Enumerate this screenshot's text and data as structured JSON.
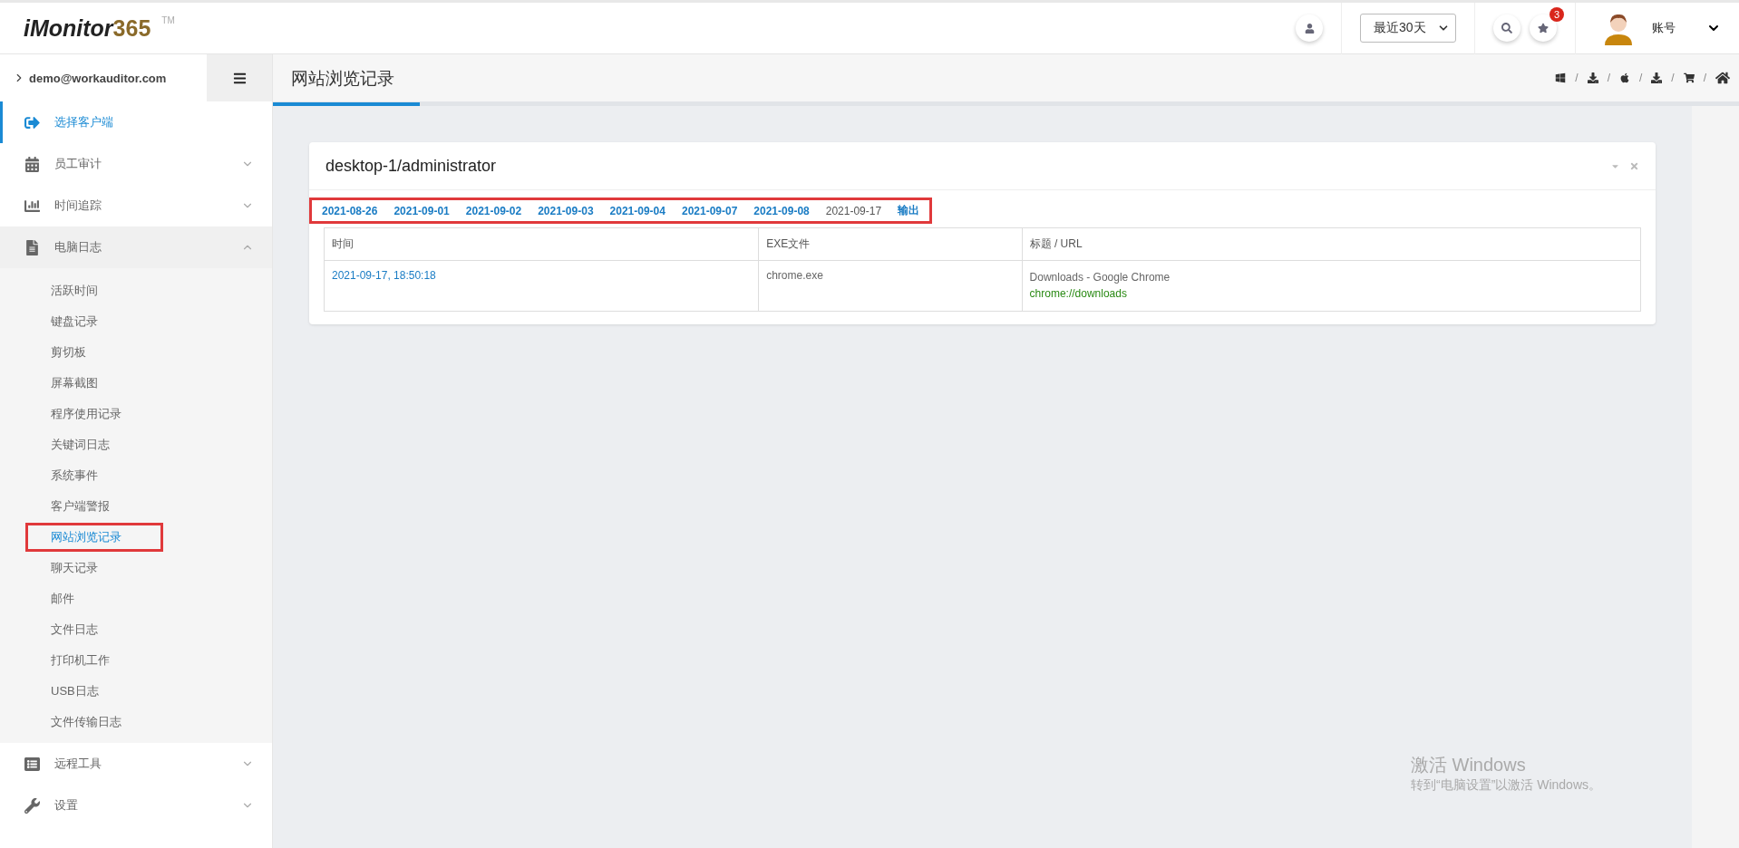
{
  "header": {
    "logo": {
      "name": "iMonitor",
      "number": "365",
      "tm": "TM"
    },
    "period_select": {
      "value": "最近30天"
    },
    "notification_count": "3",
    "account": "账号"
  },
  "sidebar": {
    "user": "demo@workauditor.com",
    "items": [
      {
        "label": "选择客户端",
        "selected": true
      },
      {
        "label": "员工审计",
        "selected": false,
        "expanded": false
      },
      {
        "label": "时间追踪",
        "selected": false,
        "expanded": false
      },
      {
        "label": "电脑日志",
        "selected": false,
        "expanded": true,
        "children": [
          {
            "label": "活跃时间",
            "selected": false,
            "highlighted": false
          },
          {
            "label": "键盘记录",
            "selected": false,
            "highlighted": false
          },
          {
            "label": "剪切板",
            "selected": false,
            "highlighted": false
          },
          {
            "label": "屏幕截图",
            "selected": false,
            "highlighted": false
          },
          {
            "label": "程序使用记录",
            "selected": false,
            "highlighted": false
          },
          {
            "label": "关键词日志",
            "selected": false,
            "highlighted": false
          },
          {
            "label": "系统事件",
            "selected": false,
            "highlighted": false
          },
          {
            "label": "客户端警报",
            "selected": false,
            "highlighted": false
          },
          {
            "label": "网站浏览记录",
            "selected": true,
            "highlighted": true
          },
          {
            "label": "聊天记录",
            "selected": false,
            "highlighted": false
          },
          {
            "label": "邮件",
            "selected": false,
            "highlighted": false
          },
          {
            "label": "文件日志",
            "selected": false,
            "highlighted": false
          },
          {
            "label": "打印机工作",
            "selected": false,
            "highlighted": false
          },
          {
            "label": "USB日志",
            "selected": false,
            "highlighted": false
          },
          {
            "label": "文件传输日志",
            "selected": false,
            "highlighted": false
          }
        ]
      },
      {
        "label": "远程工具",
        "selected": false,
        "expanded": false
      },
      {
        "label": "设置",
        "selected": false,
        "expanded": false
      }
    ]
  },
  "page_title": "网站浏览记录",
  "toolbar": {
    "separators": [
      "/",
      "/",
      "/",
      "/",
      "/"
    ]
  },
  "panel": {
    "title": "desktop-1/administrator",
    "date_bar": {
      "highlighted": true,
      "dates": [
        {
          "label": "2021-08-26",
          "selected": false
        },
        {
          "label": "2021-09-01",
          "selected": false
        },
        {
          "label": "2021-09-02",
          "selected": false
        },
        {
          "label": "2021-09-03",
          "selected": false
        },
        {
          "label": "2021-09-04",
          "selected": false
        },
        {
          "label": "2021-09-07",
          "selected": false
        },
        {
          "label": "2021-09-08",
          "selected": false
        },
        {
          "label": "2021-09-17",
          "selected": true
        }
      ],
      "export": "输出"
    },
    "table": {
      "columns": [
        "时间",
        "EXE文件",
        "标题 / URL"
      ],
      "rows": [
        {
          "time": "2021-09-17, 18:50:18",
          "exe": "chrome.exe",
          "title": "Downloads - Google Chrome",
          "url": "chrome://downloads"
        }
      ]
    }
  },
  "os_notice": {
    "title": "激活 Windows",
    "text": "转到“电脑设置”以激活 Windows。"
  }
}
